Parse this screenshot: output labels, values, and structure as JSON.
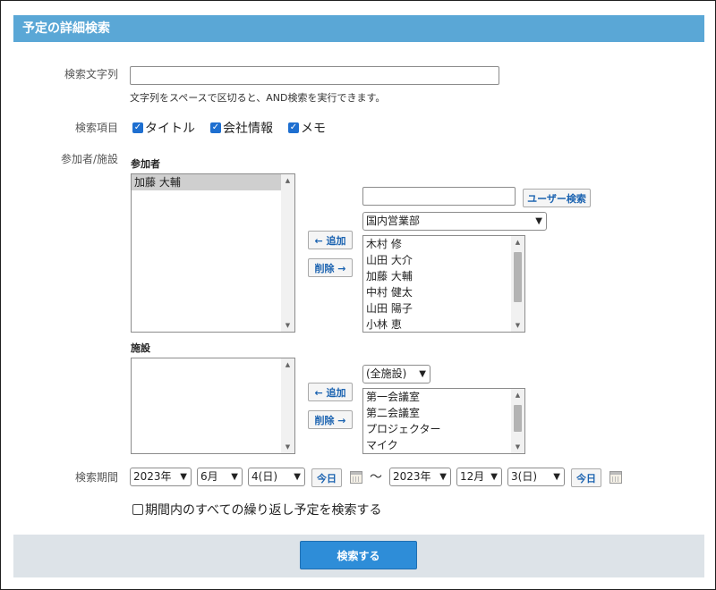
{
  "title": "予定の詳細検索",
  "keyword": {
    "label": "検索文字列",
    "value": "",
    "hint": "文字列をスペースで区切ると、AND検索を実行できます。"
  },
  "fields": {
    "label": "検索項目",
    "items": [
      {
        "label": "タイトル",
        "checked": true
      },
      {
        "label": "会社情報",
        "checked": true
      },
      {
        "label": "メモ",
        "checked": true
      }
    ]
  },
  "participants_facilities": {
    "label": "参加者/施設",
    "participants": {
      "label": "参加者",
      "selected_list": [
        "加藤 大輔"
      ],
      "search_value": "",
      "user_search_label": "ユーザー検索",
      "org_select": "国内営業部",
      "add_label": "← 追加",
      "remove_label": "削除 →",
      "candidates": [
        "木村 修",
        "山田 大介",
        "加藤 大輔",
        "中村 健太",
        "山田 陽子",
        "小林 恵"
      ]
    },
    "facilities": {
      "label": "施設",
      "selected_list": [],
      "group_select": "(全施設)",
      "add_label": "← 追加",
      "remove_label": "削除 →",
      "candidates": [
        "第一会議室",
        "第二会議室",
        "プロジェクター",
        "マイク"
      ]
    }
  },
  "period": {
    "label": "検索期間",
    "start": {
      "year": "2023年",
      "month": "6月",
      "day": "4(日)"
    },
    "end": {
      "year": "2023年",
      "month": "12月",
      "day": "3(日)"
    },
    "today_label": "今日",
    "separator": "〜",
    "repeat_option": {
      "label": "期間内のすべての繰り返し予定を検索する",
      "checked": false
    }
  },
  "submit_label": "検索する"
}
